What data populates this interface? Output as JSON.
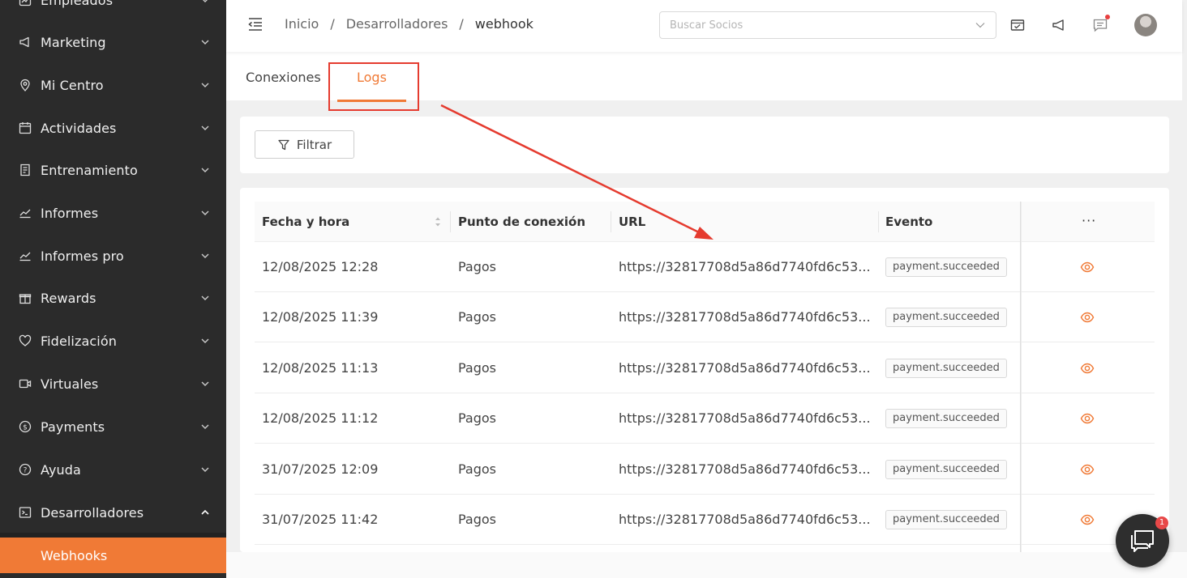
{
  "sidebar": {
    "items": [
      {
        "label": "Empleados",
        "icon": "chart-icon",
        "expanded": false
      },
      {
        "label": "Marketing",
        "icon": "megaphone-icon",
        "expanded": false
      },
      {
        "label": "Mi Centro",
        "icon": "location-pin-icon",
        "expanded": false
      },
      {
        "label": "Actividades",
        "icon": "calendar-icon",
        "expanded": false
      },
      {
        "label": "Entrenamiento",
        "icon": "document-icon",
        "expanded": false
      },
      {
        "label": "Informes",
        "icon": "line-chart-icon",
        "expanded": false
      },
      {
        "label": "Informes pro",
        "icon": "line-chart-icon",
        "expanded": false
      },
      {
        "label": "Rewards",
        "icon": "gift-icon",
        "expanded": false
      },
      {
        "label": "Fidelización",
        "icon": "heart-icon",
        "expanded": false
      },
      {
        "label": "Virtuales",
        "icon": "video-icon",
        "expanded": false
      },
      {
        "label": "Payments",
        "icon": "dollar-icon",
        "expanded": false
      },
      {
        "label": "Ayuda",
        "icon": "help-icon",
        "expanded": false
      },
      {
        "label": "Desarrolladores",
        "icon": "terminal-icon",
        "expanded": true
      }
    ],
    "subitem": "Webhooks",
    "accent": "#f07a36"
  },
  "header": {
    "breadcrumb": [
      "Inicio",
      "Desarrolladores",
      "webhook"
    ],
    "separator": "/",
    "search_placeholder": "Buscar Socios"
  },
  "tabs": [
    {
      "label": "Conexiones",
      "active": false
    },
    {
      "label": "Logs",
      "active": true
    }
  ],
  "filter": {
    "label": "Filtrar"
  },
  "table": {
    "columns": [
      "Fecha y hora",
      "Punto de conexión",
      "URL",
      "Evento"
    ],
    "more": "···",
    "rows": [
      {
        "date": "12/08/2025 12:28",
        "point": "Pagos",
        "url": "https://32817708d5a86d7740fd6c53...",
        "event": "payment.succeeded"
      },
      {
        "date": "12/08/2025 11:39",
        "point": "Pagos",
        "url": "https://32817708d5a86d7740fd6c53...",
        "event": "payment.succeeded"
      },
      {
        "date": "12/08/2025 11:13",
        "point": "Pagos",
        "url": "https://32817708d5a86d7740fd6c53...",
        "event": "payment.succeeded"
      },
      {
        "date": "12/08/2025 11:12",
        "point": "Pagos",
        "url": "https://32817708d5a86d7740fd6c53...",
        "event": "payment.succeeded"
      },
      {
        "date": "31/07/2025 12:09",
        "point": "Pagos",
        "url": "https://32817708d5a86d7740fd6c53...",
        "event": "payment.succeeded"
      },
      {
        "date": "31/07/2025 11:42",
        "point": "Pagos",
        "url": "https://32817708d5a86d7740fd6c53...",
        "event": "payment.succeeded"
      }
    ]
  },
  "chat": {
    "badge": "1"
  },
  "colors": {
    "annotation": "#e53b2f",
    "notification_dot": "#e84040"
  }
}
